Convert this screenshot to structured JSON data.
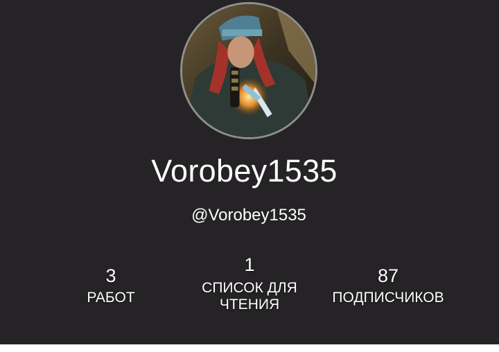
{
  "profile": {
    "display_name": "Vorobey1535",
    "handle": "@Vorobey1535",
    "avatar_alt": "avatar"
  },
  "stats": {
    "works": {
      "count": "3",
      "label": "РАБОТ"
    },
    "reading_lists": {
      "count": "1",
      "label": "СПИСОК ДЛЯ ЧТЕНИЯ"
    },
    "followers": {
      "count": "87",
      "label": "ПОДПИСЧИКОВ"
    }
  },
  "colors": {
    "header_background": "#252325",
    "text": "#ffffff",
    "avatar_border": "#8f8f8f"
  }
}
